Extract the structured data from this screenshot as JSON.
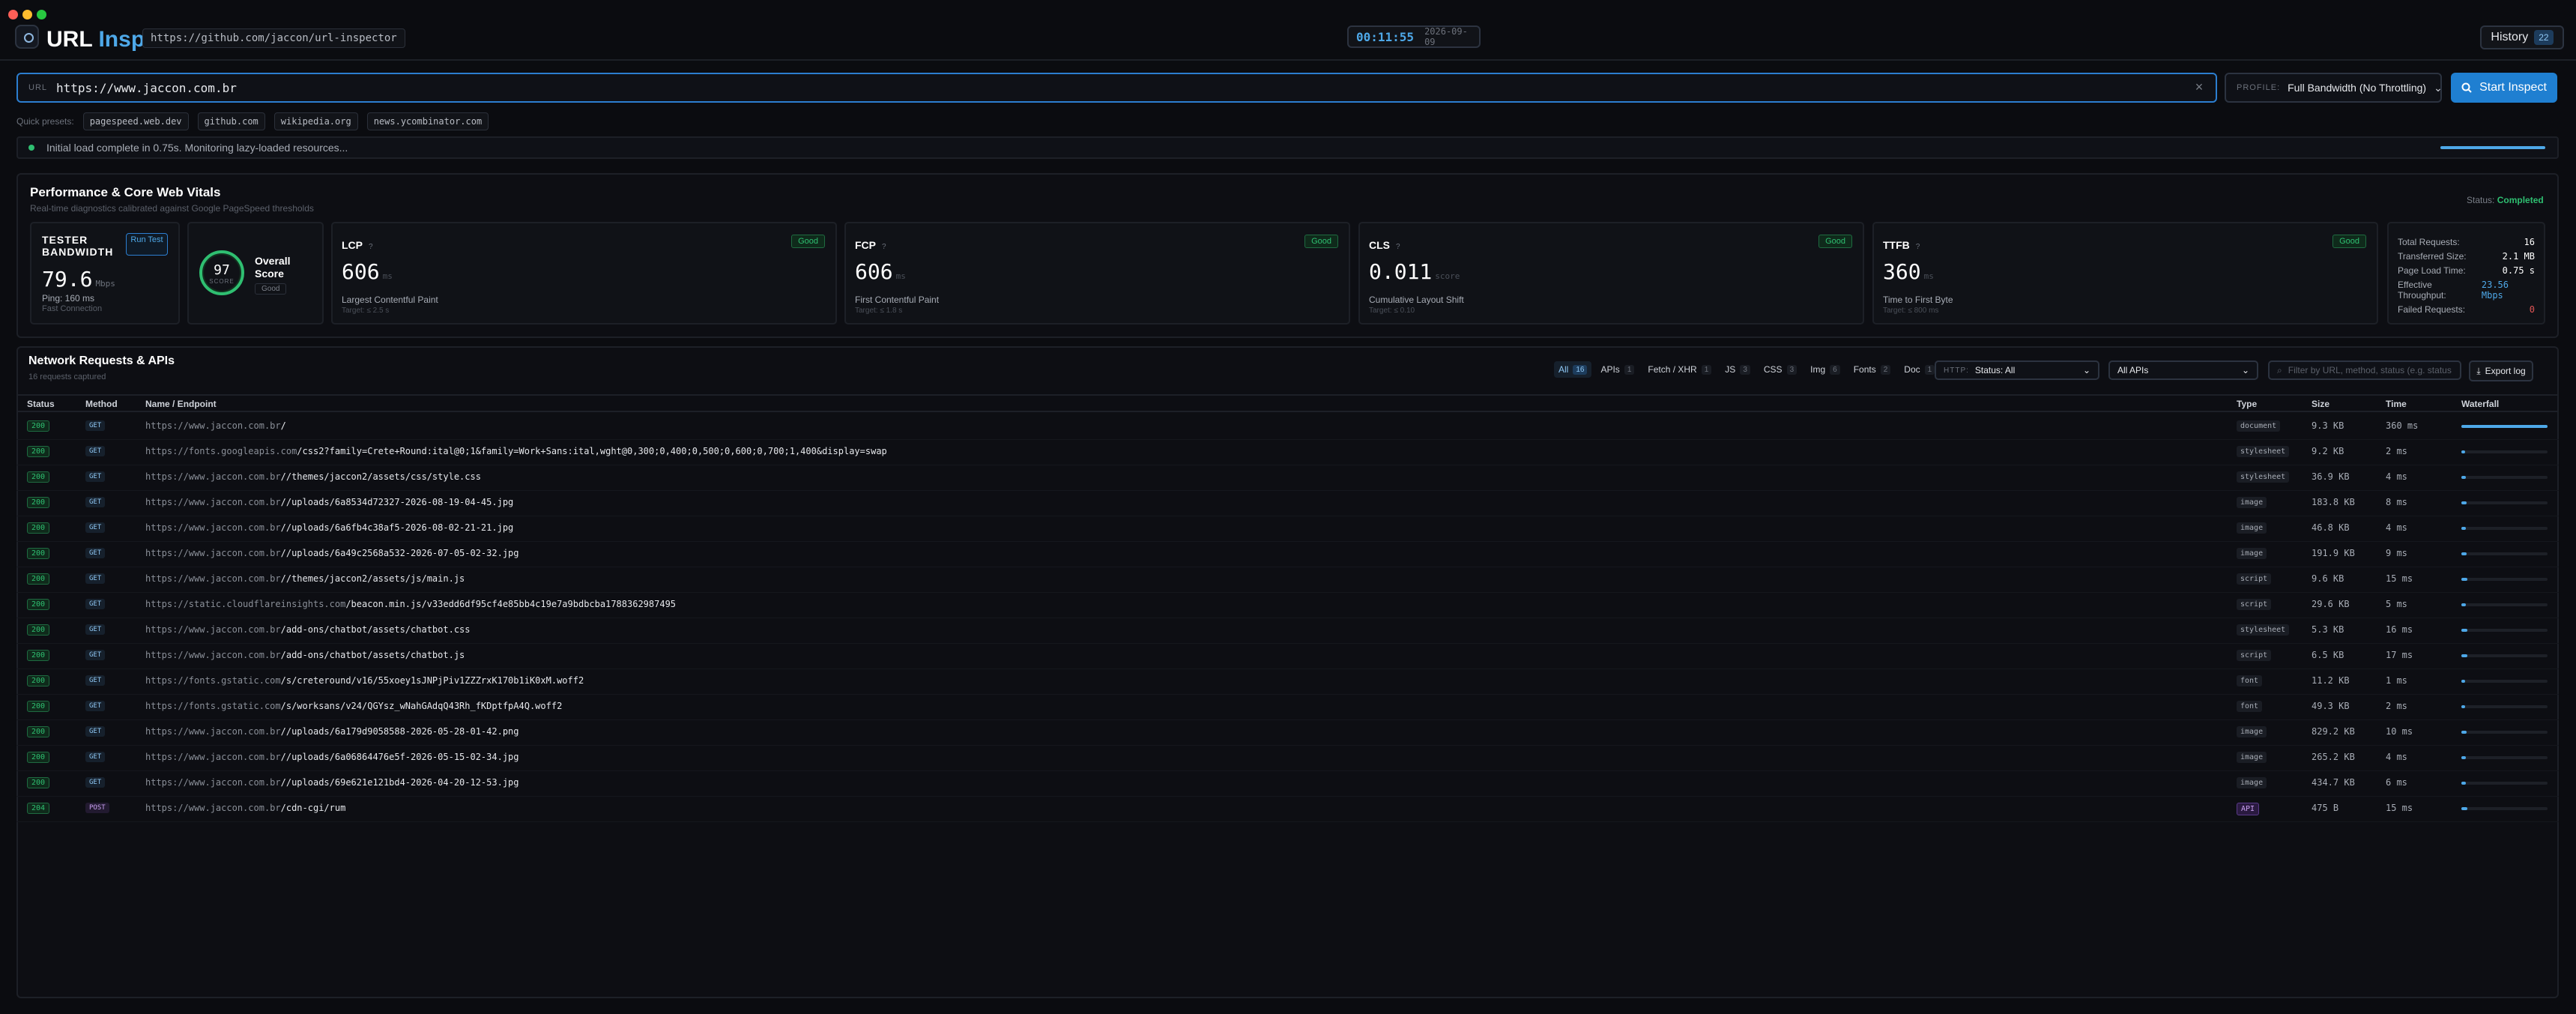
{
  "window": {
    "dots": [
      "#ff5f57",
      "#febc2e",
      "#28c840"
    ]
  },
  "header": {
    "app_name_part1": "URL",
    "app_name_part2": "Inspector",
    "repo": "https://github.com/jaccon/url-inspector",
    "clock_time": "00:11:55",
    "clock_date": "2026-09-09",
    "history_label": "History",
    "history_count": "22"
  },
  "urlbar": {
    "prefix": "URL",
    "value": "https://www.jaccon.com.br",
    "clear_icon": "×",
    "profile_label": "PROFILE:",
    "profile_value": "Full Bandwidth (No Throttling)",
    "start_label": "Start Inspect"
  },
  "presets": {
    "label": "Quick presets:",
    "items": [
      "pagespeed.web.dev",
      "github.com",
      "wikipedia.org",
      "news.ycombinator.com"
    ]
  },
  "statusbar": {
    "message": "Initial load complete in 0.75s. Monitoring lazy-loaded resources...",
    "progress": 1.0
  },
  "perf": {
    "title": "Performance & Core Web Vitals",
    "subtitle": "Real-time diagnostics calibrated against Google PageSpeed thresholds",
    "status_label": "Status:",
    "status_value": "Completed",
    "bandwidth": {
      "title": "TESTER BANDWIDTH",
      "run_label": "Run Test",
      "value": "79.6",
      "unit": "Mbps",
      "ping": "Ping: 160 ms",
      "connection": "Fast Connection"
    },
    "score": {
      "value": "97",
      "sublabel": "SCORE",
      "label": "Overall Score",
      "grade": "Good"
    },
    "metrics": [
      {
        "name": "LCP",
        "help": "?",
        "badge": "Good",
        "value": "606",
        "unit": "ms",
        "desc": "Largest Contentful Paint",
        "target": "Target: ≤ 2.5 s"
      },
      {
        "name": "FCP",
        "help": "?",
        "badge": "Good",
        "value": "606",
        "unit": "ms",
        "desc": "First Contentful Paint",
        "target": "Target: ≤ 1.8 s"
      },
      {
        "name": "CLS",
        "help": "?",
        "badge": "Good",
        "value": "0.011",
        "unit": "score",
        "desc": "Cumulative Layout Shift",
        "target": "Target: ≤ 0.10"
      },
      {
        "name": "TTFB",
        "help": "?",
        "badge": "Good",
        "value": "360",
        "unit": "ms",
        "desc": "Time to First Byte",
        "target": "Target: ≤ 800 ms"
      }
    ],
    "summary": [
      {
        "label": "Total Requests:",
        "value": "16",
        "color": "#ffffff"
      },
      {
        "label": "Transferred Size:",
        "value": "2.1 MB",
        "color": "#ffffff"
      },
      {
        "label": "Page Load Time:",
        "value": "0.75 s",
        "color": "#ffffff"
      },
      {
        "label": "Effective Throughput:",
        "value": "23.56 Mbps",
        "color": "#4ea8e8"
      },
      {
        "label": "Failed Requests:",
        "value": "0",
        "color": "#e05555"
      }
    ]
  },
  "network": {
    "title": "Network Requests & APIs",
    "subtitle": "16 requests captured",
    "tabs": [
      {
        "label": "All",
        "count": "16",
        "active": true
      },
      {
        "label": "APIs",
        "count": "1",
        "active": false
      },
      {
        "label": "Fetch / XHR",
        "count": "1",
        "active": false
      },
      {
        "label": "JS",
        "count": "3",
        "active": false
      },
      {
        "label": "CSS",
        "count": "3",
        "active": false
      },
      {
        "label": "Img",
        "count": "6",
        "active": false
      },
      {
        "label": "Fonts",
        "count": "2",
        "active": false
      },
      {
        "label": "Doc",
        "count": "1",
        "active": false
      }
    ],
    "http_filter_label": "HTTP:",
    "http_filter_value": "Status: All",
    "api_filter_value": "All APIs",
    "search_placeholder": "Filter by URL, method, status (e.g. status",
    "export_label": "Export log",
    "columns": {
      "status": "Status",
      "method": "Method",
      "name": "Name / Endpoint",
      "type": "Type",
      "size": "Size",
      "time": "Time",
      "waterfall": "Waterfall"
    },
    "rows": [
      {
        "status": "200",
        "method": "GET",
        "host": "https://www.jaccon.com.br",
        "path": "/",
        "type": "document",
        "size": "9.3 KB",
        "time": "360 ms",
        "waterfall": 1.0
      },
      {
        "status": "200",
        "method": "GET",
        "host": "https://fonts.googleapis.com",
        "path": "/css2?family=Crete+Round:ital@0;1&family=Work+Sans:ital,wght@0,300;0,400;0,500;0,600;0,700;1,400&display=swap",
        "type": "stylesheet",
        "size": "9.2 KB",
        "time": "2 ms",
        "waterfall": 0.04
      },
      {
        "status": "200",
        "method": "GET",
        "host": "https://www.jaccon.com.br",
        "path": "//themes/jaccon2/assets/css/style.css",
        "type": "stylesheet",
        "size": "36.9 KB",
        "time": "4 ms",
        "waterfall": 0.05
      },
      {
        "status": "200",
        "method": "GET",
        "host": "https://www.jaccon.com.br",
        "path": "//uploads/6a8534d72327-2026-08-19-04-45.jpg",
        "type": "image",
        "size": "183.8 KB",
        "time": "8 ms",
        "waterfall": 0.06
      },
      {
        "status": "200",
        "method": "GET",
        "host": "https://www.jaccon.com.br",
        "path": "//uploads/6a6fb4c38af5-2026-08-02-21-21.jpg",
        "type": "image",
        "size": "46.8 KB",
        "time": "4 ms",
        "waterfall": 0.05
      },
      {
        "status": "200",
        "method": "GET",
        "host": "https://www.jaccon.com.br",
        "path": "//uploads/6a49c2568a532-2026-07-05-02-32.jpg",
        "type": "image",
        "size": "191.9 KB",
        "time": "9 ms",
        "waterfall": 0.06
      },
      {
        "status": "200",
        "method": "GET",
        "host": "https://www.jaccon.com.br",
        "path": "//themes/jaccon2/assets/js/main.js",
        "type": "script",
        "size": "9.6 KB",
        "time": "15 ms",
        "waterfall": 0.07
      },
      {
        "status": "200",
        "method": "GET",
        "host": "https://static.cloudflareinsights.com",
        "path": "/beacon.min.js/v33edd6df95cf4e85bb4c19e7a9bdbcba1788362987495",
        "type": "script",
        "size": "29.6 KB",
        "time": "5 ms",
        "waterfall": 0.05
      },
      {
        "status": "200",
        "method": "GET",
        "host": "https://www.jaccon.com.br",
        "path": "/add-ons/chatbot/assets/chatbot.css",
        "type": "stylesheet",
        "size": "5.3 KB",
        "time": "16 ms",
        "waterfall": 0.07
      },
      {
        "status": "200",
        "method": "GET",
        "host": "https://www.jaccon.com.br",
        "path": "/add-ons/chatbot/assets/chatbot.js",
        "type": "script",
        "size": "6.5 KB",
        "time": "17 ms",
        "waterfall": 0.07
      },
      {
        "status": "200",
        "method": "GET",
        "host": "https://fonts.gstatic.com",
        "path": "/s/creteround/v16/55xoey1sJNPjPiv1ZZZrxK170b1iK0xM.woff2",
        "type": "font",
        "size": "11.2 KB",
        "time": "1 ms",
        "waterfall": 0.04
      },
      {
        "status": "200",
        "method": "GET",
        "host": "https://fonts.gstatic.com",
        "path": "/s/worksans/v24/QGYsz_wNahGAdqQ43Rh_fKDptfpA4Q.woff2",
        "type": "font",
        "size": "49.3 KB",
        "time": "2 ms",
        "waterfall": 0.04
      },
      {
        "status": "200",
        "method": "GET",
        "host": "https://www.jaccon.com.br",
        "path": "//uploads/6a179d9058588-2026-05-28-01-42.png",
        "type": "image",
        "size": "829.2 KB",
        "time": "10 ms",
        "waterfall": 0.06
      },
      {
        "status": "200",
        "method": "GET",
        "host": "https://www.jaccon.com.br",
        "path": "//uploads/6a06864476e5f-2026-05-15-02-34.jpg",
        "type": "image",
        "size": "265.2 KB",
        "time": "4 ms",
        "waterfall": 0.05
      },
      {
        "status": "200",
        "method": "GET",
        "host": "https://www.jaccon.com.br",
        "path": "//uploads/69e621e121bd4-2026-04-20-12-53.jpg",
        "type": "image",
        "size": "434.7 KB",
        "time": "6 ms",
        "waterfall": 0.05
      },
      {
        "status": "204",
        "method": "POST",
        "host": "https://www.jaccon.com.br",
        "path": "/cdn-cgi/rum",
        "type": "API",
        "size": "475 B",
        "time": "15 ms",
        "waterfall": 0.07
      }
    ]
  }
}
